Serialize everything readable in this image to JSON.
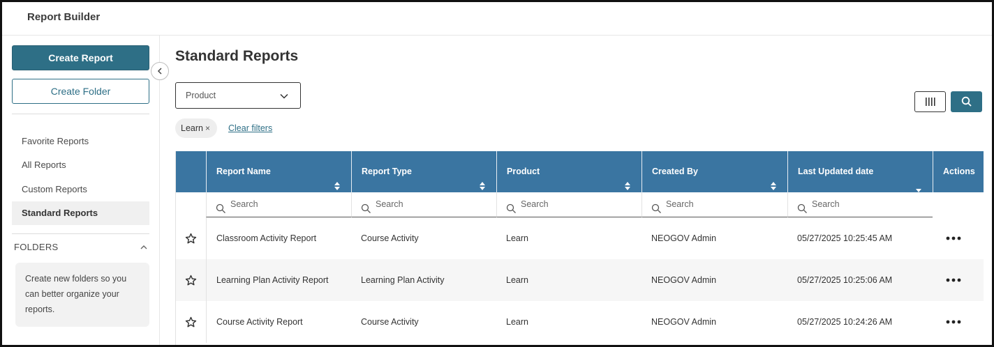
{
  "app": {
    "title": "Report Builder"
  },
  "sidebar": {
    "create_report": "Create Report",
    "create_folder": "Create Folder",
    "nav": [
      {
        "label": "Favorite Reports",
        "active": false
      },
      {
        "label": "All Reports",
        "active": false
      },
      {
        "label": "Custom Reports",
        "active": false
      },
      {
        "label": "Standard Reports",
        "active": true
      }
    ],
    "folders_heading": "FOLDERS",
    "folders_note": "Create new folders so you can better organize your reports."
  },
  "main": {
    "title": "Standard Reports",
    "filter_select": "Product",
    "chip": {
      "label": "Learn",
      "remove": "×"
    },
    "clear_filters": "Clear filters"
  },
  "table": {
    "columns": [
      "Report Name",
      "Report Type",
      "Product",
      "Created By",
      "Last Updated date",
      "Actions"
    ],
    "search_placeholder": "Search",
    "rows": [
      {
        "name": "Classroom Activity Report",
        "type": "Course Activity",
        "product": "Learn",
        "created_by": "NEOGOV Admin",
        "updated": "05/27/2025 10:25:45 AM"
      },
      {
        "name": "Learning Plan Activity Report",
        "type": "Learning Plan Activity",
        "product": "Learn",
        "created_by": "NEOGOV Admin",
        "updated": "05/27/2025 10:25:06 AM"
      },
      {
        "name": "Course Activity Report",
        "type": "Course Activity",
        "product": "Learn",
        "created_by": "NEOGOV Admin",
        "updated": "05/27/2025 10:24:26 AM"
      }
    ]
  },
  "colors": {
    "accent": "#2e6f86",
    "header": "#3a75a1"
  }
}
